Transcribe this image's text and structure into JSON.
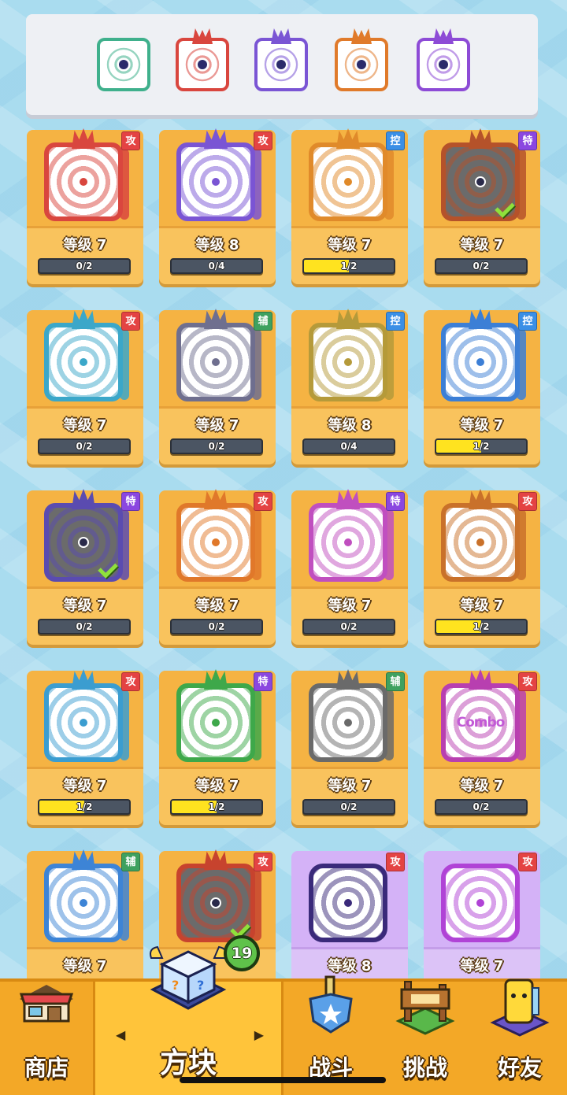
{
  "equipped": [
    {
      "icon": "healing-hands-icon",
      "color": "#3fb08c"
    },
    {
      "icon": "black-hole-icon",
      "color": "#d9463e"
    },
    {
      "icon": "orbit-ring-icon",
      "color": "#7a55d4"
    },
    {
      "icon": "infinity-combo-icon",
      "color": "#e07a2a"
    },
    {
      "icon": "cracked-ice-icon",
      "color": "#8d4bd6"
    }
  ],
  "cards": [
    {
      "type": "攻",
      "type_kind": "atk",
      "level": "等级 7",
      "progress": "0/2",
      "fill": 0,
      "theme": "#d9463e",
      "icon": "sunburst-icon",
      "equipped": false,
      "rarity": "gold"
    },
    {
      "type": "攻",
      "type_kind": "atk",
      "level": "等级 8",
      "progress": "0/4",
      "fill": 0,
      "theme": "#7a55d4",
      "icon": "gear-ring-icon",
      "equipped": false,
      "rarity": "gold"
    },
    {
      "type": "控",
      "type_kind": "ctl",
      "level": "等级 7",
      "progress": "1/2",
      "fill": 0.5,
      "theme": "#e08a2a",
      "icon": "sand-icon",
      "equipped": false,
      "rarity": "gold"
    },
    {
      "type": "特",
      "type_kind": "spc",
      "level": "等级 7",
      "progress": "0/2",
      "fill": 0,
      "theme": "#b5522a",
      "icon": "infinity-combo-icon",
      "equipped": true,
      "rarity": "gold"
    },
    {
      "type": "攻",
      "type_kind": "atk",
      "level": "等级 7",
      "progress": "0/2",
      "fill": 0,
      "theme": "#3ba7c9",
      "icon": "totem-icon",
      "equipped": false,
      "rarity": "gold"
    },
    {
      "type": "辅",
      "type_kind": "sup",
      "level": "等级 7",
      "progress": "0/2",
      "fill": 0,
      "theme": "#6f6f8f",
      "icon": "jaws-icon",
      "equipped": false,
      "rarity": "gold"
    },
    {
      "type": "控",
      "type_kind": "ctl",
      "level": "等级 8",
      "progress": "0/4",
      "fill": 0,
      "theme": "#b59a3a",
      "icon": "shield-target-icon",
      "equipped": false,
      "rarity": "gold"
    },
    {
      "type": "控",
      "type_kind": "ctl",
      "level": "等级 7",
      "progress": "1/2",
      "fill": 0.5,
      "theme": "#3c7fd6",
      "icon": "snowflake-icon",
      "equipped": false,
      "rarity": "gold"
    },
    {
      "type": "特",
      "type_kind": "spc",
      "level": "等级 7",
      "progress": "0/2",
      "fill": 0,
      "theme": "#5a4bb0",
      "icon": "orbit-ring-icon",
      "equipped": true,
      "rarity": "gold"
    },
    {
      "type": "攻",
      "type_kind": "atk",
      "level": "等级 7",
      "progress": "0/2",
      "fill": 0,
      "theme": "#e0782a",
      "icon": "flame-swirl-icon",
      "equipped": false,
      "rarity": "gold"
    },
    {
      "type": "特",
      "type_kind": "spc",
      "level": "等级 7",
      "progress": "0/2",
      "fill": 0,
      "theme": "#c04fbf",
      "icon": "syringe-icon",
      "equipped": false,
      "rarity": "gold"
    },
    {
      "type": "攻",
      "type_kind": "atk",
      "level": "等级 7",
      "progress": "1/2",
      "fill": 0.5,
      "theme": "#c9712a",
      "icon": "pistol-icon",
      "equipped": false,
      "rarity": "gold"
    },
    {
      "type": "攻",
      "type_kind": "atk",
      "level": "等级 7",
      "progress": "1/2",
      "fill": 0.5,
      "theme": "#3b9dd0",
      "icon": "whirlpool-icon",
      "equipped": false,
      "rarity": "gold"
    },
    {
      "type": "特",
      "type_kind": "spc",
      "level": "等级 7",
      "progress": "1/2",
      "fill": 0.5,
      "theme": "#3ea84a",
      "icon": "seaweed-icon",
      "equipped": false,
      "rarity": "gold"
    },
    {
      "type": "辅",
      "type_kind": "sup",
      "level": "等级 7",
      "progress": "0/2",
      "fill": 0,
      "theme": "#6a6a6a",
      "icon": "stopwatch-icon",
      "equipped": false,
      "rarity": "gold"
    },
    {
      "type": "攻",
      "type_kind": "atk",
      "level": "等级 7",
      "progress": "0/2",
      "fill": 0,
      "theme": "#b83fb0",
      "icon": "combo-text-icon",
      "word": "Combo",
      "equipped": false,
      "rarity": "gold"
    },
    {
      "type": "辅",
      "type_kind": "sup",
      "level": "等级 7",
      "progress": "",
      "fill": 0,
      "theme": "#3d84d6",
      "icon": "crescent-moon-icon",
      "equipped": false,
      "rarity": "gold"
    },
    {
      "type": "攻",
      "type_kind": "atk",
      "level": "",
      "progress": "",
      "fill": 0,
      "theme": "#c7432e",
      "icon": "black-hole-icon",
      "equipped": true,
      "rarity": "gold"
    },
    {
      "type": "攻",
      "type_kind": "atk",
      "level": "等级 8",
      "progress": "",
      "fill": 0,
      "theme": "#3a2a7a",
      "icon": "scythe-icon",
      "equipped": false,
      "rarity": "purple"
    },
    {
      "type": "攻",
      "type_kind": "atk",
      "level": "等级 7",
      "progress": "",
      "fill": 0,
      "theme": "#b043d6",
      "icon": "pixel-burst-icon",
      "equipped": false,
      "rarity": "purple"
    }
  ],
  "pending_count": "19",
  "nav": [
    {
      "label": "商店",
      "icon": "shop-icon",
      "active": false
    },
    {
      "label": "方块",
      "icon": "mystery-cube-icon",
      "active": true
    },
    {
      "label": "战斗",
      "icon": "sword-shield-icon",
      "active": false
    },
    {
      "label": "挑战",
      "icon": "signpost-icon",
      "active": false
    },
    {
      "label": "好友",
      "icon": "yellow-buddy-icon",
      "active": false
    }
  ],
  "nav_arrows": {
    "left": "◀",
    "right": "▶"
  },
  "colors": {
    "accent": "#f3a827",
    "progress_fill": "#ffe31f",
    "background": "#a9dcef"
  }
}
